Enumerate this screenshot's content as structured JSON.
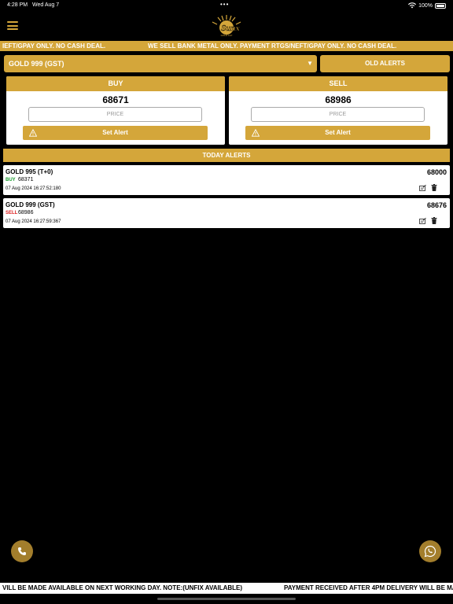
{
  "status": {
    "time": "4:28 PM",
    "date": "Wed Aug 7",
    "battery": "100%"
  },
  "brand": {
    "logo_text": "Sunx",
    "accent": "#d4a63a"
  },
  "ticker_top": {
    "segment_1": "IEFT/GPAY ONLY. NO CASH DEAL.",
    "segment_2": "WE SELL BANK METAL ONLY. PAYMENT RTGS/NEFT/GPAY ONLY. NO CASH DEAL."
  },
  "product_select": {
    "selected": "GOLD 999 (GST)"
  },
  "old_alerts_label": "OLD ALERTS",
  "buy_panel": {
    "title": "BUY",
    "price": "68671",
    "input_placeholder": "PRICE",
    "button_label": "Set Alert"
  },
  "sell_panel": {
    "title": "SELL",
    "price": "68986",
    "input_placeholder": "PRICE",
    "button_label": "Set Alert"
  },
  "today_alerts_label": "TODAY ALERTS",
  "alerts": [
    {
      "name": "GOLD 995 (T+0)",
      "side": "BUY",
      "side_value": "68371",
      "timestamp": "07 Aug 2024 16:27:52:180",
      "target": "68000"
    },
    {
      "name": "GOLD 999 (GST)",
      "side": "SELL",
      "side_value": "68986",
      "timestamp": "07 Aug 2024 16:27:59:367",
      "target": "68676"
    }
  ],
  "ticker_bottom": {
    "segment_1": "VILL BE MADE AVAILABLE ON NEXT WORKING DAY.  NOTE:(UNFIX AVAILABLE)",
    "segment_2": "PAYMENT RECEIVED AFTER 4PM DELIVERY WILL BE MA"
  },
  "icons": {
    "menu": "hamburger-icon",
    "phone": "phone-icon",
    "whatsapp": "whatsapp-icon",
    "warning": "warning-icon",
    "edit": "edit-icon",
    "delete": "trash-icon"
  }
}
